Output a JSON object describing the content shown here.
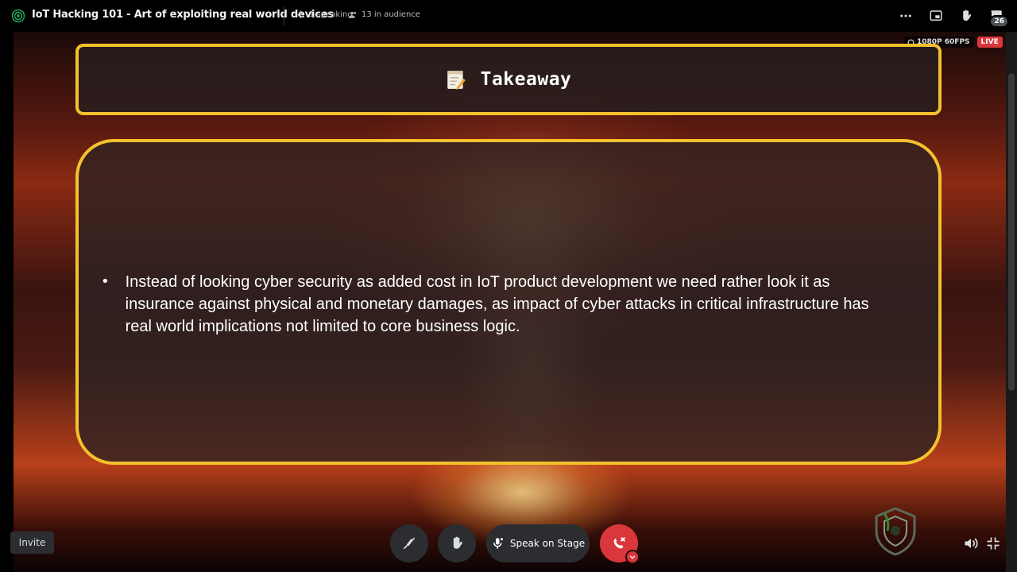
{
  "header": {
    "title": "IoT Hacking 101 - Art of exploiting real world devices",
    "speaking": "1 speaking",
    "audience": "13 in audience",
    "chat_badge": "26"
  },
  "stream": {
    "quality": "1080P 60FPS",
    "live": "LIVE"
  },
  "slide": {
    "title": "Takeaway",
    "bullets": [
      "Instead of looking cyber security as added cost in IoT product development we need rather look it as insurance against physical and monetary damages, as impact of cyber attacks in critical infrastructure has real world implications not limited to core business logic."
    ]
  },
  "controls": {
    "invite_label": "Invite",
    "speak_label": "Speak on Stage"
  },
  "colors": {
    "accent": "#f3c12e",
    "danger": "#da373c",
    "control_bg": "#2b2d31"
  }
}
